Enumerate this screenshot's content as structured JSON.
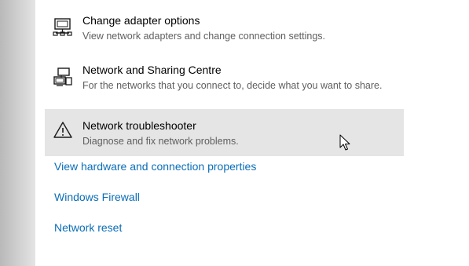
{
  "options": [
    {
      "title": "Change adapter options",
      "description": "View network adapters and change connection settings.",
      "icon": "network-adapter-icon"
    },
    {
      "title": "Network and Sharing Centre",
      "description": "For the networks that you connect to, decide what you want to share.",
      "icon": "sharing-centre-icon"
    },
    {
      "title": "Network troubleshooter",
      "description": "Diagnose and fix network problems.",
      "icon": "warning-icon"
    }
  ],
  "links": {
    "hardware": "View hardware and connection properties",
    "firewall": "Windows Firewall",
    "reset": "Network reset"
  },
  "colors": {
    "link": "#0a6eb8",
    "hover_background": "#e5e5e5",
    "sidebar_gray": "#c8c8c8"
  }
}
